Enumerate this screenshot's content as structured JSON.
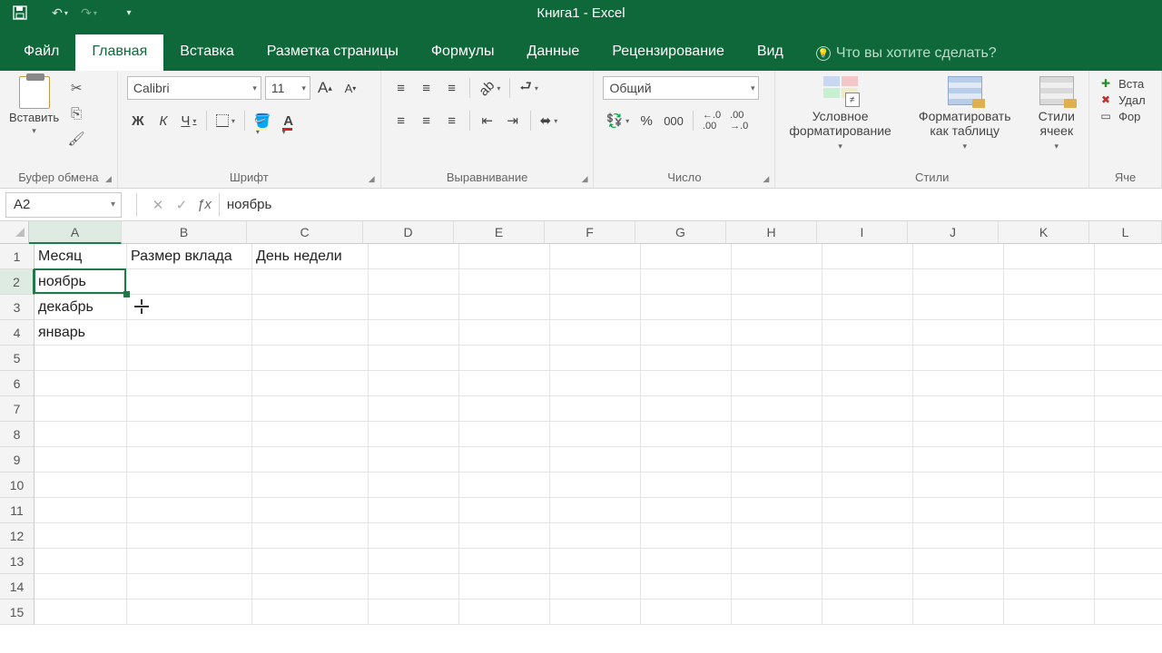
{
  "app_title": "Книга1 - Excel",
  "qat": {
    "save": "💾",
    "undo": "↶",
    "redo": "↷",
    "customize": "▾"
  },
  "tabs": {
    "file": "Файл",
    "home": "Главная",
    "insert": "Вставка",
    "layout": "Разметка страницы",
    "formulas": "Формулы",
    "data": "Данные",
    "review": "Рецензирование",
    "view": "Вид"
  },
  "tellme": "Что вы хотите сделать?",
  "ribbon": {
    "clipboard": {
      "paste": "Вставить",
      "label": "Буфер обмена"
    },
    "font": {
      "name": "Calibri",
      "size": "11",
      "bold": "Ж",
      "italic": "К",
      "underline": "Ч",
      "grow": "A",
      "shrink": "A",
      "label": "Шрифт"
    },
    "alignment": {
      "label": "Выравнивание"
    },
    "number": {
      "format": "Общий",
      "label": "Число"
    },
    "styles": {
      "cond": "Условное\nформатирование",
      "table": "Форматировать\nкак таблицу",
      "cell": "Стили\nячеек",
      "label": "Стили"
    },
    "cells": {
      "insert": "Вста",
      "delete": "Удал",
      "format": "Фор",
      "label": "Яче"
    }
  },
  "formula_bar": {
    "name_box": "A2",
    "formula": "ноябрь"
  },
  "columns": [
    {
      "letter": "A",
      "width": 102,
      "selected": true
    },
    {
      "letter": "B",
      "width": 138
    },
    {
      "letter": "C",
      "width": 128
    },
    {
      "letter": "D",
      "width": 100
    },
    {
      "letter": "E",
      "width": 100
    },
    {
      "letter": "F",
      "width": 100
    },
    {
      "letter": "G",
      "width": 100
    },
    {
      "letter": "H",
      "width": 100
    },
    {
      "letter": "I",
      "width": 100
    },
    {
      "letter": "J",
      "width": 100
    },
    {
      "letter": "K",
      "width": 100
    },
    {
      "letter": "L",
      "width": 80
    }
  ],
  "rows": 15,
  "selected_row": 2,
  "data_cells": {
    "A1": "Месяц",
    "B1": "Размер вклада",
    "C1": "День недели",
    "A2": "ноябрь",
    "A3": "декабрь",
    "A4": "январь"
  },
  "active_cell": "A2",
  "cursor_at": {
    "col": "B",
    "row": 3
  }
}
